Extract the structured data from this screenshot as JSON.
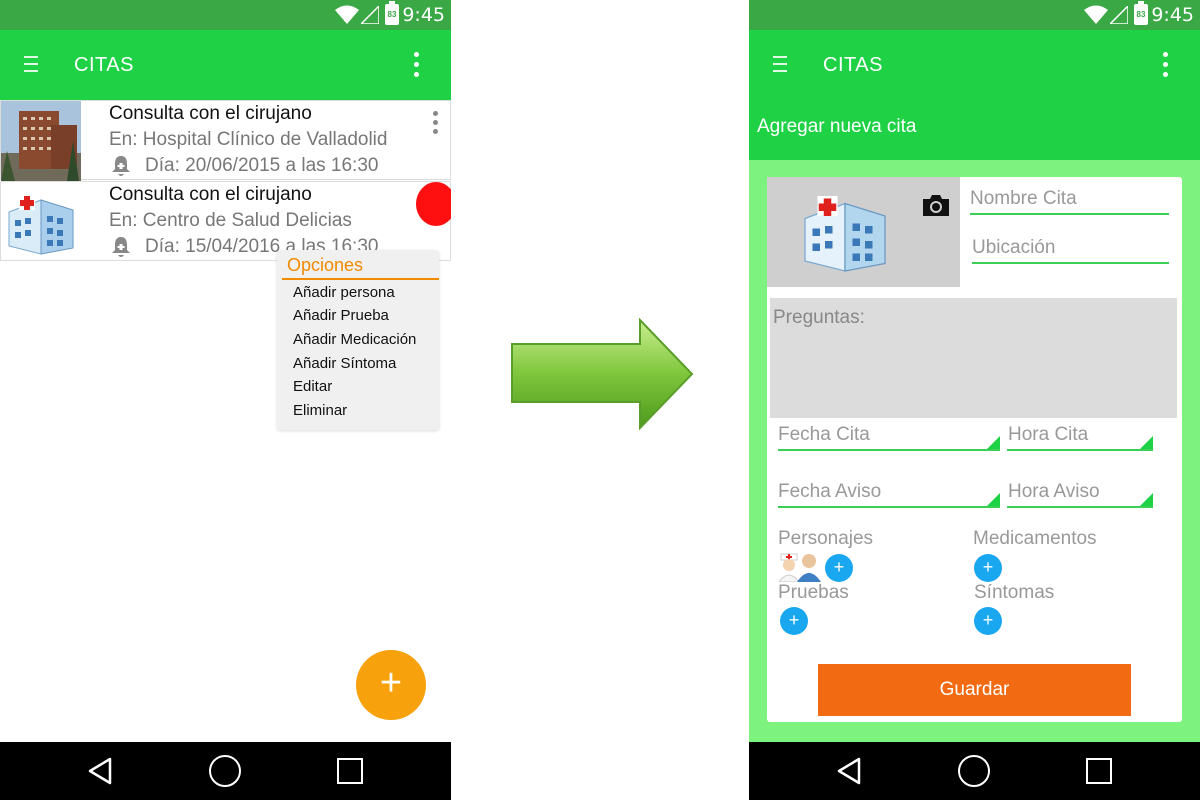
{
  "status": {
    "time": "9:45",
    "battery": "83"
  },
  "left": {
    "appbar": {
      "title": "CITAS"
    },
    "appointments": [
      {
        "title": "Consulta con el cirujano",
        "location": "En: Hospital Clínico de Valladolid",
        "date": "Día: 20/06/2015 a las 16:30",
        "thumb": "hospital-photo"
      },
      {
        "title": "Consulta con el cirujano",
        "location": "En: Centro de Salud Delicias",
        "date": "Día: 15/04/2016 a las 16:30",
        "thumb": "hospital-icon"
      }
    ],
    "options_menu": {
      "title": "Opciones",
      "items": [
        "Añadir persona",
        "Añadir Prueba",
        "Añadir Medicación",
        "Añadir Síntoma",
        "Editar",
        "Eliminar"
      ]
    },
    "fab": "+"
  },
  "right": {
    "appbar": {
      "title": "CITAS"
    },
    "subheader": "Agregar nueva cita",
    "form": {
      "nombre_placeholder": "Nombre Cita",
      "ubicacion_placeholder": "Ubicación",
      "preguntas_label": "Preguntas:",
      "fecha_cita": "Fecha Cita",
      "hora_cita": "Hora Cita",
      "fecha_aviso": "Fecha Aviso",
      "hora_aviso": "Hora Aviso",
      "personajes": "Personajes",
      "medicamentos": "Medicamentos",
      "pruebas": "Pruebas",
      "sintomas": "Síntomas",
      "add_symbol": "+",
      "save": "Guardar"
    }
  },
  "colors": {
    "status_bar": "#3aa844",
    "app_bar": "#1fd145",
    "form_bg": "#7ef27f",
    "accent_orange": "#f7a10c",
    "save_button": "#f26a12",
    "add_button": "#19a7f0"
  }
}
